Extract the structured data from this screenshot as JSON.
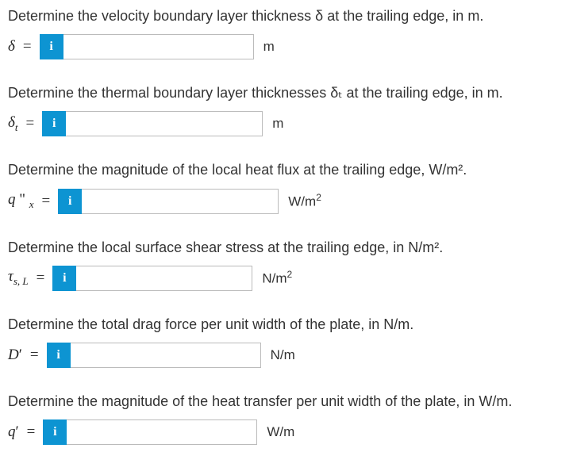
{
  "questions": [
    {
      "prompt": "Determine the velocity boundary layer thickness δ at the trailing edge, in m.",
      "var_html": "<i>δ</i>",
      "unit_html": "m",
      "input_width": "w-240"
    },
    {
      "prompt": "Determine the thermal boundary layer thicknesses δₜ at the trailing edge, in m.",
      "var_html": "<i>δ</i><span class='sub'>t</span>",
      "unit_html": "m",
      "input_width": "w-248"
    },
    {
      "prompt": "Determine the magnitude of the local heat flux at the trailing edge, W/m².",
      "var_html": "<i>q</i> <span class='prime'>&quot;</span> <span class='sub'>x</span>",
      "unit_html": "W/m<span class='unit-sup'>2</span>",
      "input_width": "w-248"
    },
    {
      "prompt": "Determine the local surface shear stress at the trailing edge, in N/m².",
      "var_html": "<i>τ</i><span class='sub'>s, L</span>",
      "unit_html": "N/m<span class='unit-sup'>2</span>",
      "input_width": "w-222"
    },
    {
      "prompt": "Determine the total drag force per unit width of the plate, in N/m.",
      "var_html": "<i>D</i><span class='prime'>′</span>",
      "unit_html": "N/m",
      "input_width": "w-240"
    },
    {
      "prompt": "Determine the magnitude of the heat transfer per unit width of the plate, in W/m.",
      "var_html": "<i>q</i><span class='prime'>′</span>",
      "unit_html": "W/m",
      "input_width": "w-240"
    }
  ],
  "info_symbol": "i",
  "equals": "="
}
